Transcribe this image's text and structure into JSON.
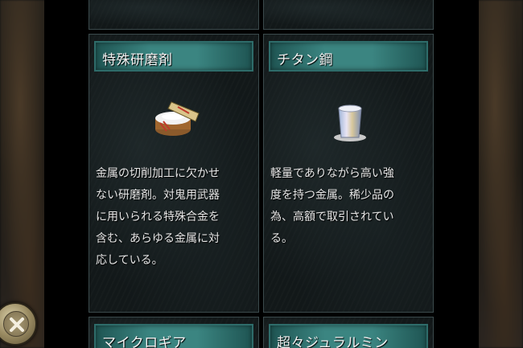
{
  "items": [
    {
      "name": "特殊研磨剤",
      "description_lines": [
        "金属の切削加工に欠かせ",
        "ない研磨剤。対鬼用武器",
        "に用いられる特殊合金を",
        "含む、あらゆる金属に対",
        "応している。"
      ],
      "icon": "abrasive-box-icon"
    },
    {
      "name": "チタン鋼",
      "description_lines": [
        "軽量でありながら高い強",
        "度を持つ金属。稀少品の",
        "為、高額で取引されてい",
        "る。"
      ],
      "icon": "titanium-ingot-icon"
    },
    {
      "name": "マイクロギア",
      "icon": ""
    },
    {
      "name": "超々ジュラルミン",
      "icon": ""
    }
  ],
  "close_button": {
    "icon": "close-icon"
  }
}
